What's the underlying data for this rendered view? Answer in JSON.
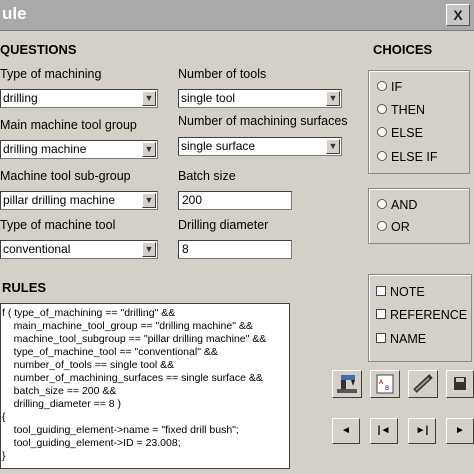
{
  "window": {
    "title": "ule",
    "close_label": "X"
  },
  "questions": {
    "heading": "QUESTIONS",
    "type_of_machining": {
      "label": "Type of machining",
      "value": "drilling"
    },
    "number_of_tools": {
      "label": "Number of tools",
      "value": "single tool"
    },
    "main_machine_tool_group": {
      "label": "Main machine tool group",
      "value": "drilling machine"
    },
    "number_of_machining_surfaces": {
      "label": "Number of machining surfaces",
      "value": "single surface"
    },
    "machine_tool_sub_group": {
      "label": "Machine tool sub-group",
      "value": "pillar drilling machine"
    },
    "batch_size": {
      "label": "Batch size",
      "value": "200"
    },
    "type_of_machine_tool": {
      "label": "Type of machine tool",
      "value": "conventional"
    },
    "drilling_diameter": {
      "label": "Drilling diameter",
      "value": "8"
    }
  },
  "choices": {
    "heading": "CHOICES",
    "conditional": [
      "IF",
      "THEN",
      "ELSE",
      "ELSE IF"
    ],
    "logical": [
      "AND",
      "OR"
    ],
    "extras": [
      "NOTE",
      "REFERENCE",
      "NAME"
    ]
  },
  "rules": {
    "heading": "RULES",
    "lines": [
      "f ( type_of_machining == \"drilling\" &&",
      "    main_machine_tool_group == \"drilling machine\" &&",
      "    machine_tool_subgroup == \"pillar drilling machine\" &&",
      "    type_of_machine_tool == \"conventional\" &&",
      "    number_of_tools == single tool &&",
      "    number_of_machining_surfaces == single surface &&",
      "    batch_size == 200 &&",
      "    drilling_diameter == 8 )",
      "{",
      "    tool_guiding_element->name = \"fixed drill bush\";",
      "    tool_guiding_element->ID = 23.008;",
      "}"
    ]
  },
  "toolbar": {
    "icons": [
      "machine-tool-icon",
      "variable-list-icon",
      "drill-tool-icon",
      "save-icon"
    ],
    "nav_labels": [
      "◄",
      "|◄",
      "►|",
      "►"
    ]
  }
}
